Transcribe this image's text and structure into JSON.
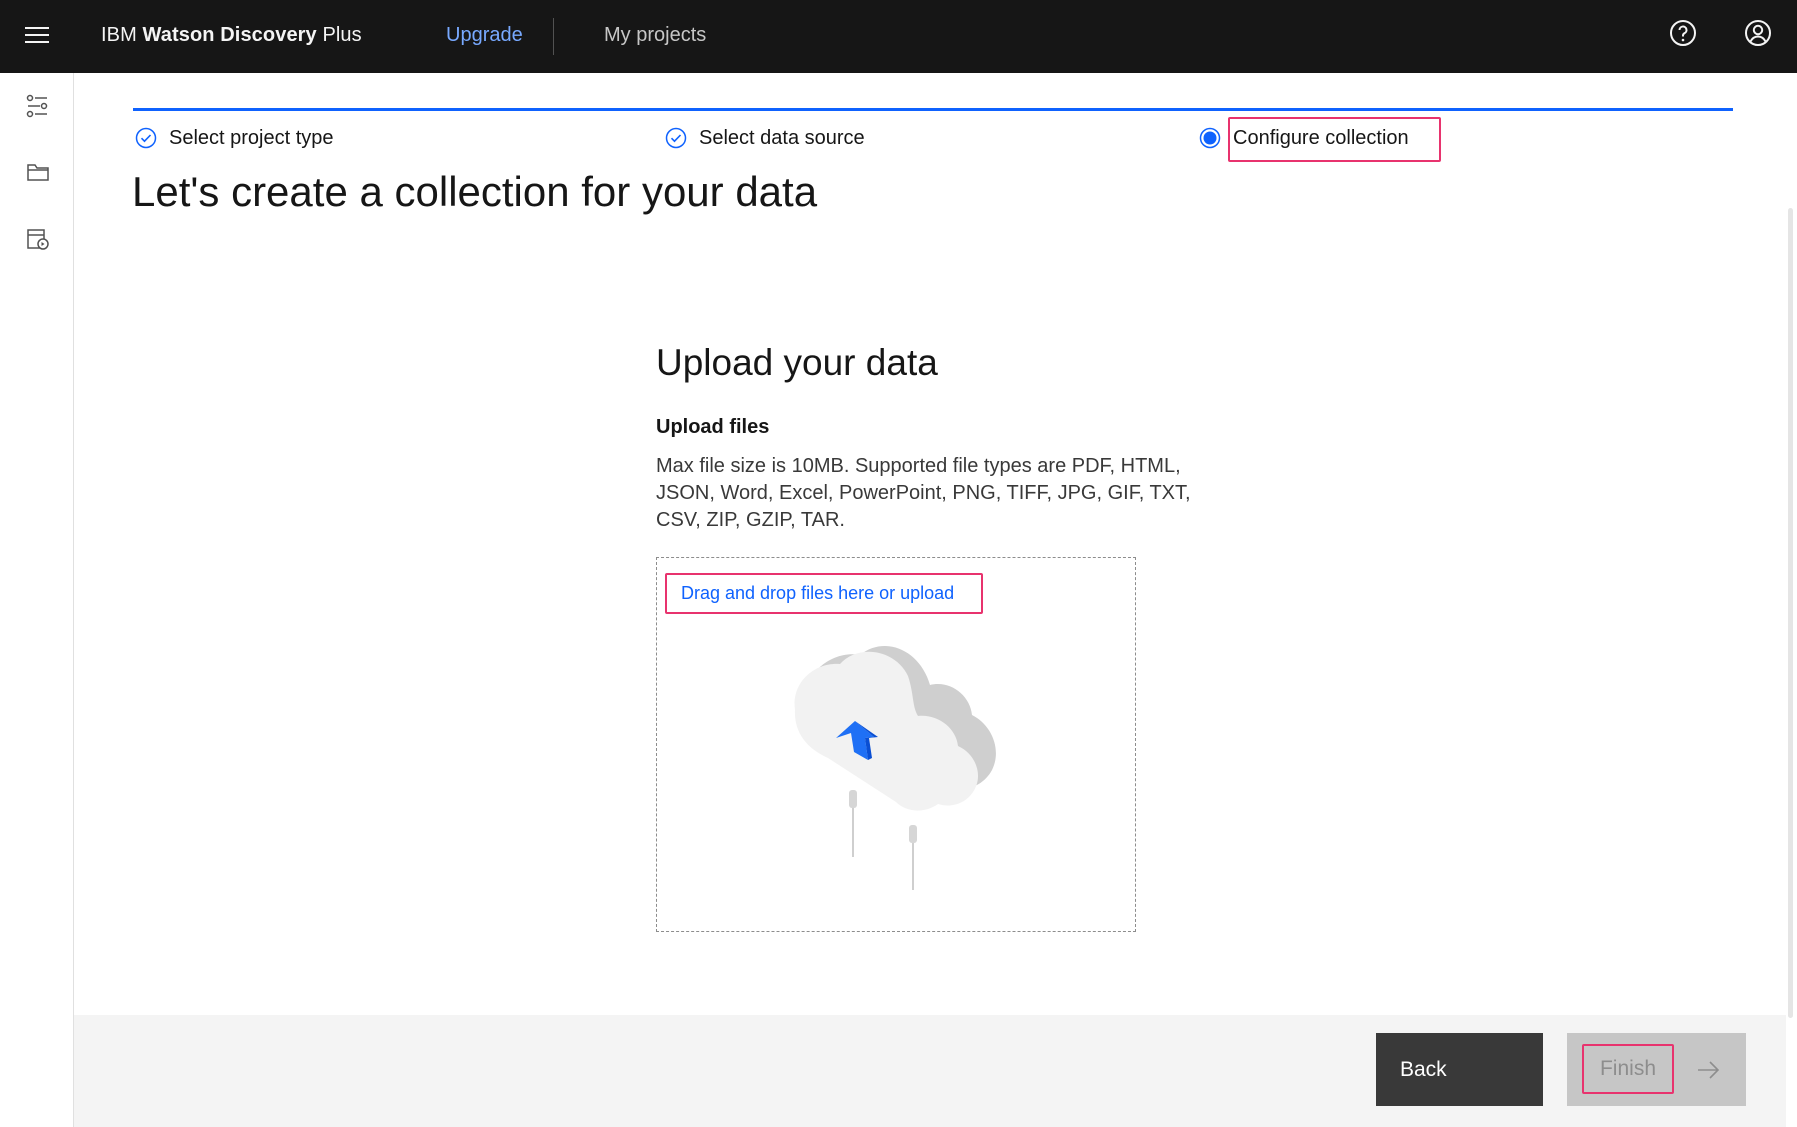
{
  "header": {
    "brand_prefix": "IBM",
    "brand_name": "Watson Discovery",
    "brand_suffix": "Plus",
    "upgrade_label": "Upgrade",
    "projects_label": "My projects",
    "icons": [
      "menu-icon",
      "help-icon",
      "user-avatar-icon"
    ]
  },
  "sidenav": {
    "icons": [
      "settings-adjust-icon",
      "folder-icon",
      "data-collection-icon"
    ]
  },
  "steps": [
    {
      "label": "Select project type",
      "state": "complete"
    },
    {
      "label": "Select data source",
      "state": "complete"
    },
    {
      "label": "Configure collection",
      "state": "current"
    }
  ],
  "page": {
    "title": "Let's create a collection for your data"
  },
  "upload": {
    "title": "Upload your data",
    "subtitle": "Upload files",
    "description": "Max file size is 10MB. Supported file types are PDF, HTML, JSON, Word, Excel, PowerPoint, PNG, TIFF, JPG, GIF, TXT, CSV, ZIP, GZIP, TAR.",
    "drop_label": "Drag and drop files here or upload"
  },
  "footer": {
    "back_label": "Back",
    "finish_label": "Finish"
  },
  "colors": {
    "header_bg": "#161616",
    "accent": "#0f62fe",
    "link": "#78a9ff",
    "highlight": "#e8336e",
    "back_bg": "#393939",
    "disabled_bg": "#c6c6c6"
  }
}
